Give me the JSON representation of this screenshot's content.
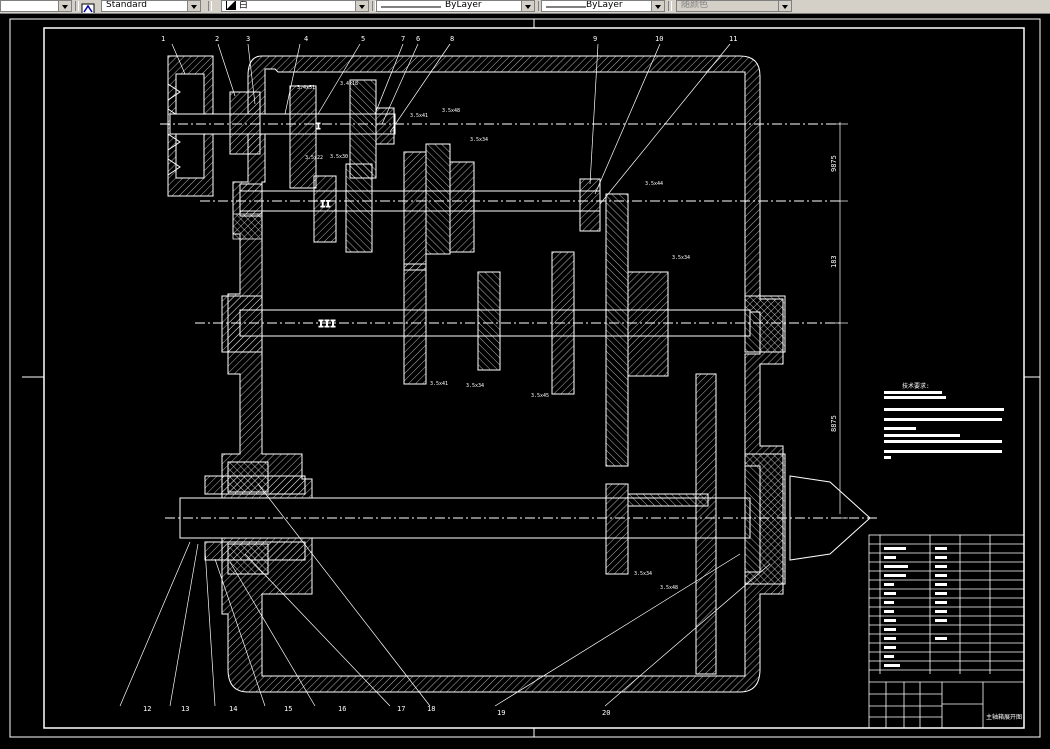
{
  "toolbar": {
    "textstyle_value": "Standard",
    "layer_value": "白",
    "linetype_value": "ByLayer",
    "lineweight_value": "ByLayer",
    "color_value": "随颜色"
  },
  "drawing": {
    "shaft_labels": [
      "I",
      "II",
      "III"
    ],
    "gear_labels": [
      "3.4x51",
      "3.4x18",
      "3.5x22",
      "3.5x30",
      "3.5x41",
      "3.5x48",
      "3.5x34",
      "3.5x44",
      "3.5x34",
      "3.5x41",
      "3.5x34",
      "3.5x45",
      "3.5x34",
      "3.5x48"
    ],
    "part_numbers_top": [
      "1",
      "2",
      "3",
      "4",
      "5",
      "7",
      "6",
      "8",
      "9",
      "10",
      "11"
    ],
    "part_numbers_bottom": [
      "12",
      "13",
      "14",
      "15",
      "16",
      "17",
      "18",
      "19",
      "20"
    ],
    "dimensions": [
      "9875",
      "183",
      "8875"
    ],
    "tech_req_title": "技术要求:",
    "title_block_name": "主轴箱展开图"
  }
}
